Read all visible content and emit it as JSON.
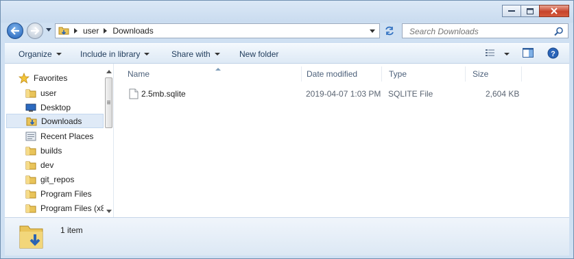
{
  "window": {
    "min_icon": "minimize-icon",
    "max_icon": "maximize-icon",
    "close_icon": "close-icon"
  },
  "nav": {
    "back_icon": "back-arrow-icon",
    "forward_icon": "forward-arrow-icon",
    "breadcrumb": [
      "user",
      "Downloads"
    ],
    "search_placeholder": "Search Downloads"
  },
  "toolbar": {
    "organize": "Organize",
    "include_in_library": "Include in library",
    "share_with": "Share with",
    "new_folder": "New folder"
  },
  "sidebar": {
    "items": [
      {
        "label": "Favorites",
        "icon": "star-icon"
      },
      {
        "label": "user",
        "icon": "folder-icon"
      },
      {
        "label": "Desktop",
        "icon": "desktop-icon"
      },
      {
        "label": "Downloads",
        "icon": "downloads-folder-icon",
        "selected": true
      },
      {
        "label": "Recent Places",
        "icon": "recent-places-icon"
      },
      {
        "label": "builds",
        "icon": "folder-icon"
      },
      {
        "label": "dev",
        "icon": "folder-icon"
      },
      {
        "label": "git_repos",
        "icon": "folder-icon"
      },
      {
        "label": "Program Files",
        "icon": "folder-icon"
      },
      {
        "label": "Program Files (x8",
        "icon": "folder-icon"
      }
    ]
  },
  "columns": {
    "name": "Name",
    "date": "Date modified",
    "type": "Type",
    "size": "Size"
  },
  "files": [
    {
      "name": "2.5mb.sqlite",
      "date": "2019-04-07 1:03 PM",
      "type": "SQLITE File",
      "size": "2,604 KB"
    }
  ],
  "status": {
    "count": "1 item"
  },
  "colors": {
    "accent": "#1f5fb8",
    "selection": "#dfeaf7",
    "folder": "#e9c45a"
  }
}
